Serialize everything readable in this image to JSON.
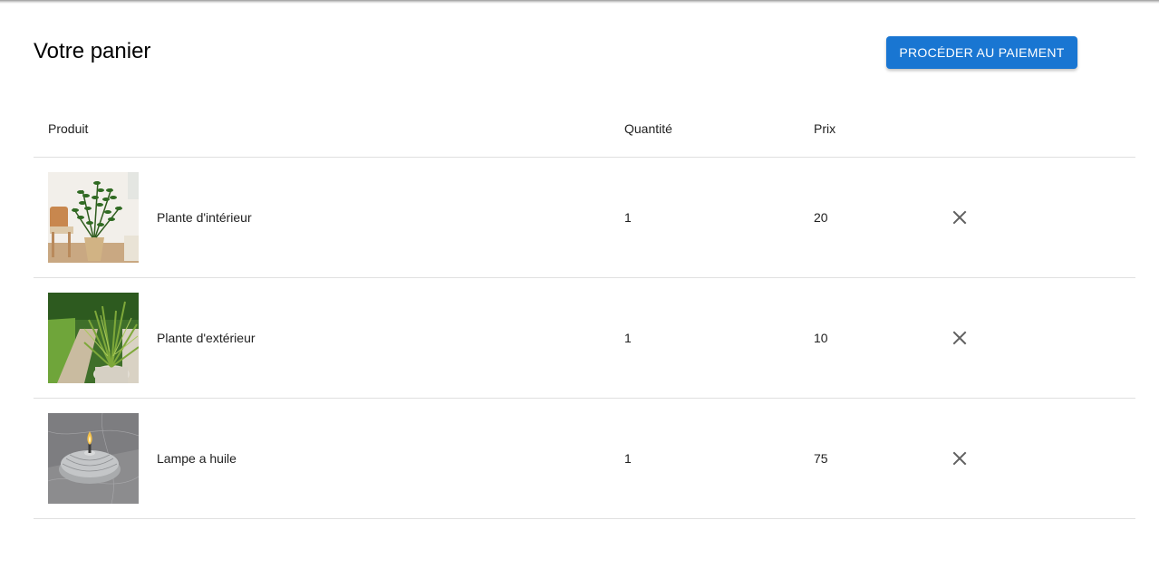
{
  "colors": {
    "accent": "#1976d2",
    "divider": "#e0e0e0",
    "remove_icon": "#616161"
  },
  "header": {
    "title": "Votre panier",
    "checkout_label": "PROCÉDER AU PAIEMENT"
  },
  "table": {
    "columns": {
      "product": "Produit",
      "quantity": "Quantité",
      "price": "Prix"
    },
    "rows": [
      {
        "name": "Plante d'intérieur",
        "quantity": "1",
        "price": "20",
        "image_icon": "indoor-plant-image",
        "remove_icon": "close-icon"
      },
      {
        "name": "Plante d'extérieur",
        "quantity": "1",
        "price": "10",
        "image_icon": "outdoor-plant-image",
        "remove_icon": "close-icon"
      },
      {
        "name": "Lampe a huile",
        "quantity": "1",
        "price": "75",
        "image_icon": "oil-lamp-image",
        "remove_icon": "close-icon"
      }
    ]
  }
}
